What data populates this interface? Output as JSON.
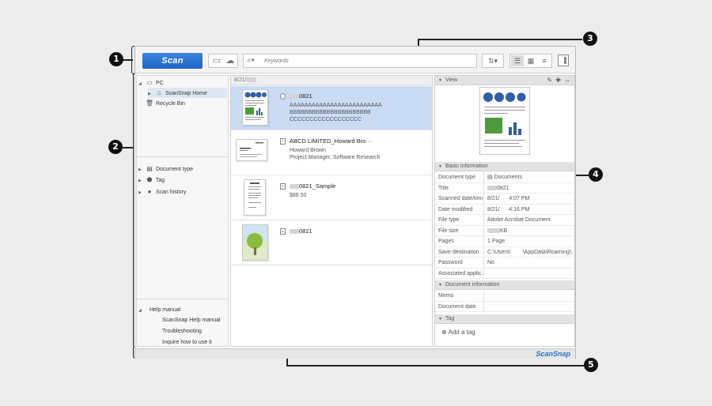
{
  "toolbar": {
    "scan_label": "Scan",
    "search_placeholder": "Keywords"
  },
  "nav": {
    "pc": "PC",
    "home": "ScanSnap Home",
    "recycle": "Recycle Bin",
    "document_type": "Document type",
    "tag": "Tag",
    "scan_history": "Scan history",
    "help_manual": "Help manual",
    "help_items": [
      "ScanSnap Help manual",
      "Troubleshooting",
      "Inquire how to use it"
    ]
  },
  "list": {
    "header_date": "8/21/",
    "files": [
      {
        "title_suffix": "0821",
        "lines": [
          "AAAAAAAAAAAAAAAAAAAAAAAAA",
          "BBBBBBBBBBBBBBBBBBBBBB",
          "CCCCCCCCCCCCCCCCCC"
        ]
      },
      {
        "title": "ABCD LIMITED_Howard Bro···",
        "lines": [
          "Howard Brown",
          "Project Manager, Software Research"
        ]
      },
      {
        "title_suffix": "0821_Sample",
        "lines": [
          "$88.50"
        ]
      },
      {
        "title_suffix": "0821",
        "lines": []
      }
    ]
  },
  "details": {
    "view_label": "View",
    "basic_info_label": "Basic information",
    "document_info_label": "Document information",
    "tag_label": "Tag",
    "add_tag": "Add a tag",
    "props": [
      {
        "key": "Document type",
        "value": "Documents"
      },
      {
        "key": "Title",
        "value": "0821"
      },
      {
        "key": "Scanned date/time",
        "value": "8/21/      4:07 PM"
      },
      {
        "key": "Date modified",
        "value": "8/21/      4:16 PM"
      },
      {
        "key": "File type",
        "value": "Adobe Acrobat Document"
      },
      {
        "key": "File size",
        "value": "KB"
      },
      {
        "key": "Pages",
        "value": "1 Page"
      },
      {
        "key": "Save destination",
        "value": "C:\\Users\\        \\AppData\\Roaming\\..."
      },
      {
        "key": "Password",
        "value": "No"
      },
      {
        "key": "Associated applic...",
        "value": ""
      }
    ],
    "doc_props": [
      {
        "key": "Memo",
        "value": ""
      },
      {
        "key": "Document date",
        "value": ""
      }
    ]
  },
  "statusbar": {
    "brand": "ScanSnap"
  },
  "callouts": [
    "1",
    "2",
    "3",
    "4",
    "5"
  ],
  "colors": {
    "accent": "#2b6fcf",
    "selection": "#c9dcf3"
  }
}
